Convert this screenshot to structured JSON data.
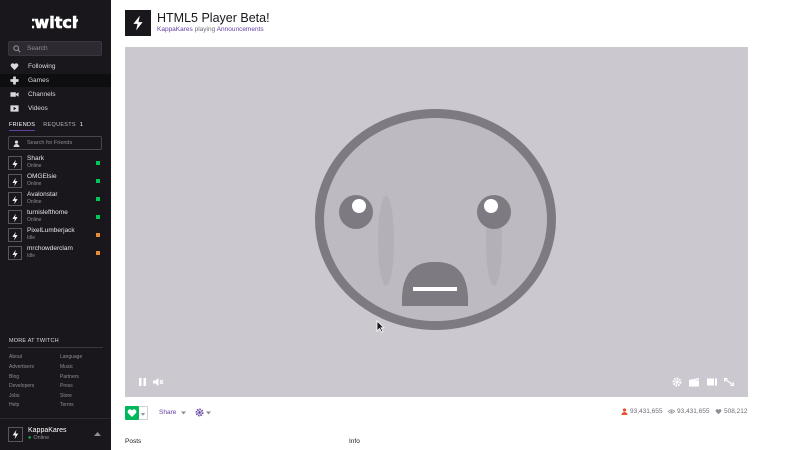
{
  "colors": {
    "brand": "#6441a4",
    "sidebar_bg": "#19171c",
    "online": "#00c957",
    "idle": "#e88c30",
    "follow": "#00b75b",
    "player_bg": "#cbc8cf"
  },
  "brand": {
    "logo_text": "twitch"
  },
  "sidebar": {
    "search_placeholder": "Search",
    "nav": [
      {
        "label": "Following",
        "icon": "heart-icon"
      },
      {
        "label": "Games",
        "icon": "gamepad-icon"
      },
      {
        "label": "Channels",
        "icon": "camera-icon"
      },
      {
        "label": "Videos",
        "icon": "play-icon"
      }
    ],
    "friends_tab": "FRIENDS",
    "requests_tab": "REQUESTS",
    "requests_count": "1",
    "friends_search_placeholder": "Search for Friends",
    "friends": [
      {
        "name": "Shark",
        "status": "Online"
      },
      {
        "name": "OMGElsie",
        "status": "Online"
      },
      {
        "name": "Avalonstar",
        "status": "Online"
      },
      {
        "name": "turnislefthome",
        "status": "Online"
      },
      {
        "name": "PixelLumberjack",
        "status": "Idle"
      },
      {
        "name": "mrchowderclam",
        "status": "Idle"
      }
    ],
    "more_title": "MORE AT TWITCH",
    "footer_links": [
      "About",
      "Language",
      "Advertisers",
      "Music",
      "Blog",
      "Partners",
      "Developers",
      "Press",
      "Jobs",
      "Store",
      "Help",
      "Terms"
    ],
    "user": {
      "name": "KappaKares",
      "status": "Online"
    }
  },
  "channel": {
    "title": "HTML5 Player Beta!",
    "streamer": "KappaKares",
    "playing_text": "playing",
    "game": "Announcements"
  },
  "player": {
    "controls_left": [
      "pause-icon",
      "volume-icon"
    ],
    "controls_right": [
      "settings-icon",
      "clip-icon",
      "theater-icon",
      "fullscreen-icon"
    ]
  },
  "actions": {
    "share_label": "Share"
  },
  "stats": {
    "followers": "93,431,655",
    "views": "93,431,655",
    "hearts": "508,212"
  },
  "sections": {
    "posts": "Posts",
    "info": "Info"
  }
}
